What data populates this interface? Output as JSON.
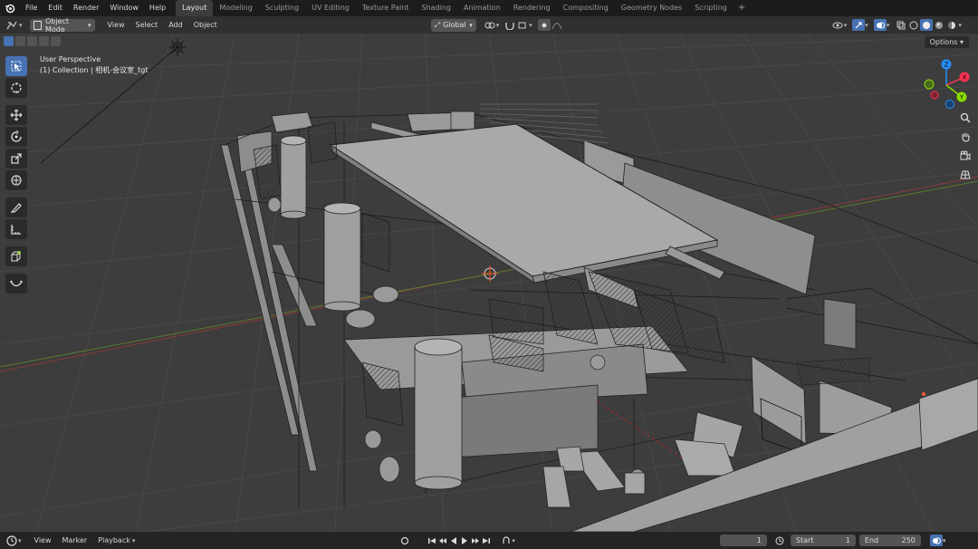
{
  "menu": {
    "items": [
      "File",
      "Edit",
      "Render",
      "Window",
      "Help"
    ]
  },
  "workspaces": {
    "tabs": [
      "Layout",
      "Modeling",
      "Sculpting",
      "UV Editing",
      "Texture Paint",
      "Shading",
      "Animation",
      "Rendering",
      "Compositing",
      "Geometry Nodes",
      "Scripting"
    ],
    "active": "Layout",
    "add_label": "+"
  },
  "header": {
    "mode": "Object Mode",
    "menus": [
      "View",
      "Select",
      "Add",
      "Object"
    ],
    "transform_orientation": "Global"
  },
  "overlay": {
    "perspective": "User Perspective",
    "collection": "(1) Collection | 相机-会议室_tgt"
  },
  "options_label": "Options",
  "gizmo": {
    "x": "X",
    "y": "Y",
    "z": "Z"
  },
  "timeline": {
    "menus": [
      "View",
      "Marker",
      "Playback"
    ],
    "current_frame": "1",
    "start_label": "Start",
    "start_value": "1",
    "end_label": "End",
    "end_value": "250"
  },
  "colors": {
    "accent": "#4772b3",
    "axis_x": "#ff3352",
    "axis_y": "#8bdc00",
    "axis_z": "#2890ff"
  }
}
